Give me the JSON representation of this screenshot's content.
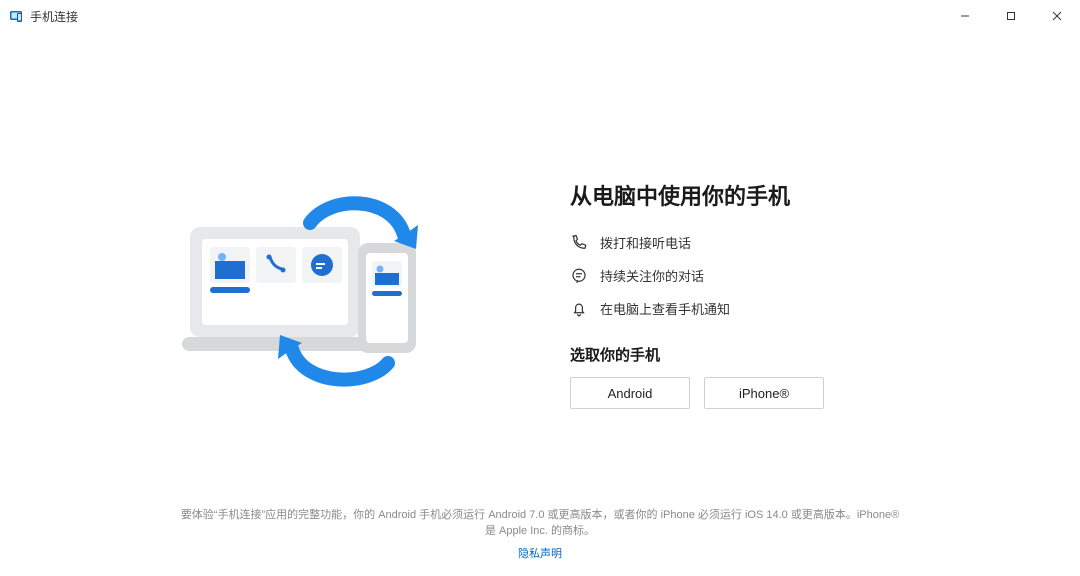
{
  "titlebar": {
    "app_name": "手机连接"
  },
  "main": {
    "heading": "从电脑中使用你的手机",
    "features": [
      {
        "icon": "phone",
        "label": "拨打和接听电话"
      },
      {
        "icon": "chat",
        "label": "持续关注你的对话"
      },
      {
        "icon": "bell",
        "label": "在电脑上查看手机通知"
      }
    ],
    "select_heading": "选取你的手机",
    "buttons": {
      "android": "Android",
      "iphone": "iPhone®"
    }
  },
  "footer": {
    "text": "要体验“手机连接”应用的完整功能，你的 Android 手机必须运行 Android 7.0 或更高版本，或者你的 iPhone 必须运行 iOS 14.0 或更高版本。iPhone® 是 Apple Inc. 的商标。",
    "privacy": "隐私声明"
  },
  "colors": {
    "accent": "#0067c0",
    "blue": "#1f6fd0"
  }
}
